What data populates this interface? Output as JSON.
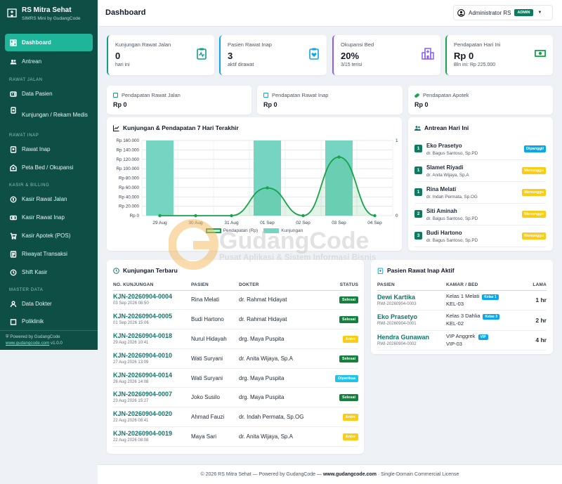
{
  "sidebar": {
    "brand_title": "RS Mitra Sehat",
    "brand_sub": "SIMRS Mini by GudangCode",
    "items": [
      {
        "label": "Dashboard",
        "icon": "dashboard-icon"
      },
      {
        "label": "Antrean",
        "icon": "users-icon"
      }
    ],
    "section_rawat_jalan": "RAWAT JALAN",
    "rawat_jalan": [
      {
        "label": "Data Pasien",
        "icon": "id-card-icon"
      },
      {
        "label": "Kunjungan / Rekam Medis",
        "icon": "file-medical-icon"
      }
    ],
    "section_rawat_inap": "RAWAT INAP",
    "rawat_inap": [
      {
        "label": "Rawat Inap",
        "icon": "bed-icon"
      },
      {
        "label": "Peta Bed / Okupansi",
        "icon": "grid-icon"
      }
    ],
    "section_kasir": "KASIR & BILLING",
    "kasir": [
      {
        "label": "Kasir Rawat Jalan",
        "icon": "cash-register-icon"
      },
      {
        "label": "Kasir Rawat Inap",
        "icon": "money-bill-icon"
      },
      {
        "label": "Kasir Apotek (POS)",
        "icon": "cart-icon"
      },
      {
        "label": "Riwayat Transaksi",
        "icon": "list-icon"
      },
      {
        "label": "Shift Kasir",
        "icon": "clock-icon"
      }
    ],
    "section_master": "MASTER DATA",
    "master": [
      {
        "label": "Data Dokter",
        "icon": "doctor-icon"
      },
      {
        "label": "Poliklinik",
        "icon": "hospital-icon"
      }
    ],
    "footer_line1": "Powered by GudangCode",
    "footer_link": "www.gudangcode.com",
    "footer_ver": " v1.0.0"
  },
  "header": {
    "title": "Dashboard",
    "user": "Administrator RS",
    "role": "ADMIN"
  },
  "stats": [
    {
      "label": "Kunjungan Rawat Jalan",
      "value": "0",
      "sub": "hari ini",
      "color": "#0f9f86",
      "icon": "clipboard-pulse-icon"
    },
    {
      "label": "Pasien Rawat Inap",
      "value": "3",
      "sub": "aktif dirawat",
      "color": "#0ea5e9",
      "icon": "clipboard-heart-icon"
    },
    {
      "label": "Okupansi Bed",
      "value": "20%",
      "sub": "3/15 terisi",
      "color": "#8b5cf6",
      "icon": "hospital-icon"
    },
    {
      "label": "Pendapatan Hari Ini",
      "value": "Rp 0",
      "sub": "Bln ini: Rp 225.000",
      "color": "#16a34a",
      "icon": "money-icon"
    }
  ],
  "mini": [
    {
      "label": "Pendapatan Rawat Jalan",
      "value": "Rp 0",
      "icon": "clipboard-icon"
    },
    {
      "label": "Pendapatan Rawat Inap",
      "value": "Rp 0",
      "icon": "hospital-icon"
    },
    {
      "label": "Pendapatan Apotek",
      "value": "Rp 0",
      "icon": "pill-icon"
    }
  ],
  "chart_title": "Kunjungan & Pendapatan 7 Hari Terakhir",
  "chart_data": {
    "type": "bar",
    "categories": [
      "29 Aug",
      "30 Aug",
      "31 Aug",
      "01 Sep",
      "02 Sep",
      "03 Sep",
      "04 Sep"
    ],
    "series": [
      {
        "name": "Pendapatan (Rp)",
        "type": "bar",
        "axis": "left",
        "values": [
          160000,
          0,
          0,
          160000,
          0,
          160000,
          0
        ],
        "color": "#76d4c2"
      },
      {
        "name": "Kunjungan",
        "type": "line",
        "axis": "right",
        "values": [
          0,
          0,
          0,
          0.37,
          0,
          0.78,
          0
        ],
        "color": "#16a34a"
      }
    ],
    "y_left_ticks": [
      "Rp 0",
      "Rp 20.000",
      "Rp 40.000",
      "Rp 60.000",
      "Rp 80.000",
      "Rp 100.000",
      "Rp 120.000",
      "Rp 140.000",
      "Rp 160.000"
    ],
    "y_left_range": [
      0,
      160000
    ],
    "y_right_ticks": [
      "0",
      "1"
    ],
    "y_right_range": [
      0,
      1
    ],
    "legend": [
      "Pendapatan (Rp)",
      "Kunjungan"
    ],
    "legend_position": "bottom",
    "grid": true
  },
  "queue": {
    "title": "Antrean Hari Ini",
    "items": [
      {
        "num": "1",
        "name": "Eko Prasetyo",
        "doctor": "dr. Bagus Santoso, Sp.PD",
        "status": "Dipanggil",
        "status_color": "#0ea5e9",
        "status_text": "#ffffff"
      },
      {
        "num": "1",
        "name": "Slamet Riyadi",
        "doctor": "dr. Anita Wijaya, Sp.A",
        "status": "Menunggu",
        "status_color": "#facc15",
        "status_text": "#ffffff"
      },
      {
        "num": "1",
        "name": "Rina Melati",
        "doctor": "dr. Indah Permata, Sp.OG",
        "status": "Menunggu",
        "status_color": "#facc15",
        "status_text": "#ffffff"
      },
      {
        "num": "2",
        "name": "Siti Aminah",
        "doctor": "dr. Bagus Santoso, Sp.PD",
        "status": "Menunggu",
        "status_color": "#facc15",
        "status_text": "#ffffff"
      },
      {
        "num": "3",
        "name": "Budi Hartono",
        "doctor": "dr. Bagus Santoso, Sp.PD",
        "status": "Menunggu",
        "status_color": "#facc15",
        "status_text": "#ffffff"
      }
    ]
  },
  "visits": {
    "title": "Kunjungan Terbaru",
    "columns": [
      "NO. KUNJUNGAN",
      "PASIEN",
      "DOKTER",
      "STATUS"
    ],
    "rows": [
      {
        "no": "KJN-20260904-0004",
        "date": "03 Sep 2026 08:50",
        "patient": "Rina Melati",
        "doctor": "dr. Rahmat Hidayat",
        "status": "Selesai",
        "color": "#15803d"
      },
      {
        "no": "KJN-20260904-0005",
        "date": "01 Sep 2026 15:06",
        "patient": "Budi Hartono",
        "doctor": "dr. Rahmat Hidayat",
        "status": "Selesai",
        "color": "#15803d"
      },
      {
        "no": "KJN-20260904-0018",
        "date": "29 Aug 2026 10:41",
        "patient": "Nurul Hidayah",
        "doctor": "drg. Maya Puspita",
        "status": "Antre",
        "color": "#facc15"
      },
      {
        "no": "KJN-20260904-0010",
        "date": "27 Aug 2026 13:09",
        "patient": "Wati Suryani",
        "doctor": "dr. Anita Wijaya, Sp.A",
        "status": "Selesai",
        "color": "#15803d"
      },
      {
        "no": "KJN-20260904-0014",
        "date": "26 Aug 2026 14:08",
        "patient": "Wati Suryani",
        "doctor": "drg. Maya Puspita",
        "status": "Diperiksa",
        "color": "#22c3e6"
      },
      {
        "no": "KJN-20260904-0007",
        "date": "23 Aug 2026 15:27",
        "patient": "Joko Susilo",
        "doctor": "drg. Maya Puspita",
        "status": "Selesai",
        "color": "#15803d"
      },
      {
        "no": "KJN-20260904-0020",
        "date": "22 Aug 2026 08:41",
        "patient": "Ahmad Fauzi",
        "doctor": "dr. Indah Permata, Sp.OG",
        "status": "Antre",
        "color": "#facc15"
      },
      {
        "no": "KJN-20260904-0019",
        "date": "22 Aug 2026 08:08",
        "patient": "Maya Sari",
        "doctor": "dr. Anita Wijaya, Sp.A",
        "status": "Antre",
        "color": "#facc15"
      }
    ]
  },
  "inpatients": {
    "title": "Pasien Rawat Inap Aktif",
    "columns": [
      "PASIEN",
      "KAMAR / BED",
      "LAMA"
    ],
    "rows": [
      {
        "name": "Dewi Kartika",
        "id": "RWI-20260904-0003",
        "room": "Kelas 1 Melati",
        "cls": "Kelas 1",
        "bed": "KEL-03",
        "days": "1 hr"
      },
      {
        "name": "Eko Prasetyo",
        "id": "RWI-20260904-0001",
        "room": "Kelas 3 Dahlia",
        "cls": "Kelas 3",
        "bed": "KEL-02",
        "days": "2 hr"
      },
      {
        "name": "Hendra Gunawan",
        "id": "RWI-20260904-0002",
        "room": "VIP Anggrek",
        "cls": "VIP",
        "bed": "VIP-03",
        "days": "4 hr"
      }
    ]
  },
  "footer": {
    "pre": "© 2026 RS Mitra Sehat — Powered by GudangCode — ",
    "link": "www.gudangcode.com",
    "post": " · Single-Domain Commercial License"
  },
  "watermark": {
    "title": "GudangCode",
    "sub": "Pusat Aplikasi & Sistem Informasi Bisnis"
  }
}
